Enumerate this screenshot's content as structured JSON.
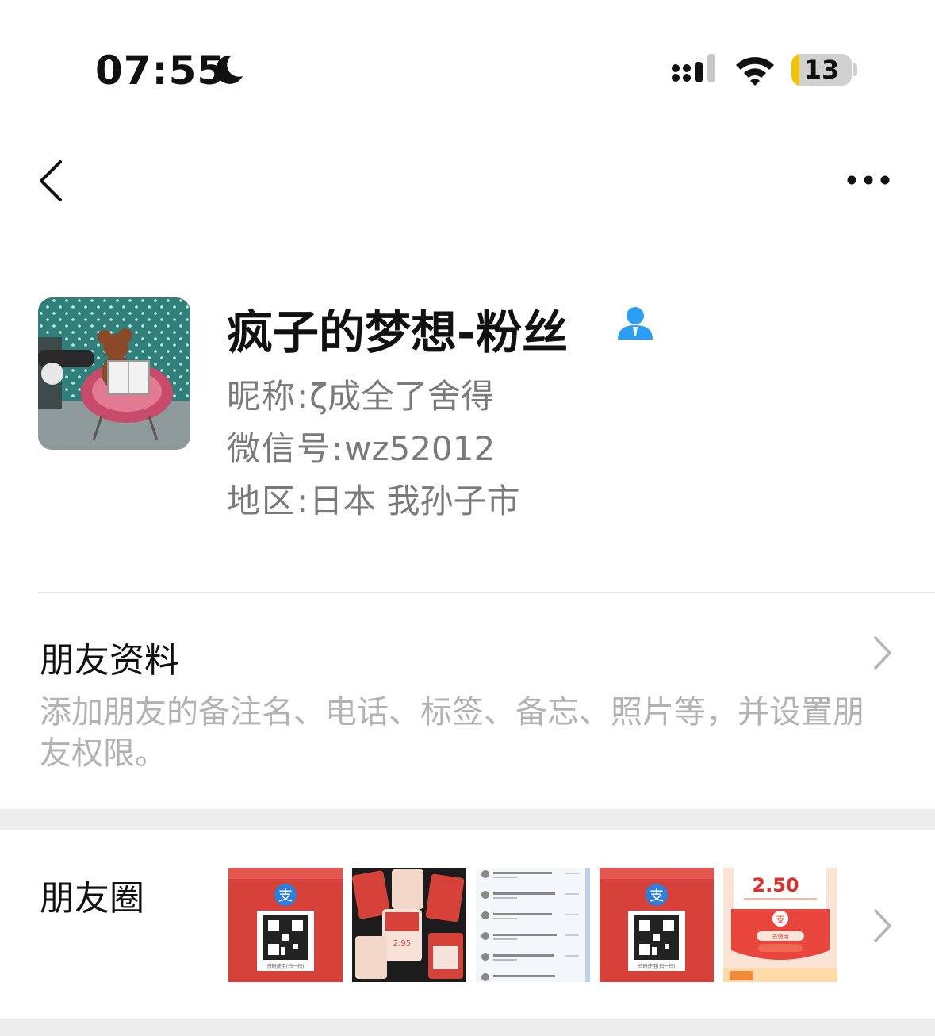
{
  "status_bar": {
    "time": "07:55",
    "battery_level": "13",
    "battery_fraction": 0.13,
    "icons": [
      "moon-icon",
      "cellular-signal-icon",
      "wifi-icon",
      "battery-icon"
    ]
  },
  "nav": {
    "back_icon": "chevron-left-icon",
    "more_icon": "more-dots-icon"
  },
  "profile": {
    "remark_name": "疯子的梦想-粉丝",
    "nickname_label": "昵称:",
    "nickname": "ζ成全了舍得",
    "wechat_id_label": "微信号:",
    "wechat_id": "wz52012",
    "region_label": "地区:",
    "region": "日本 我孙子市",
    "contact_icon": "person-icon"
  },
  "friend_info": {
    "title": "朋友资料",
    "description": "添加朋友的备注名、电话、标签、备忘、照片等，并设置朋友权限。"
  },
  "moments": {
    "title": "朋友圈",
    "thumbnails": [
      {
        "caption": "扫码使用(扫一扫)",
        "amount": ""
      },
      {
        "caption": "",
        "amount": "2.95"
      },
      {
        "caption": "",
        "amount": ""
      },
      {
        "caption": "扫码使用(扫一扫)",
        "amount": ""
      },
      {
        "caption": "去使用",
        "amount": "2.50"
      }
    ]
  },
  "colors": {
    "accent_blue": "#2a9df4",
    "red_packet": "#d6413a",
    "text_gray": "#7a7a7a",
    "hint_gray": "#b2b2b2"
  }
}
